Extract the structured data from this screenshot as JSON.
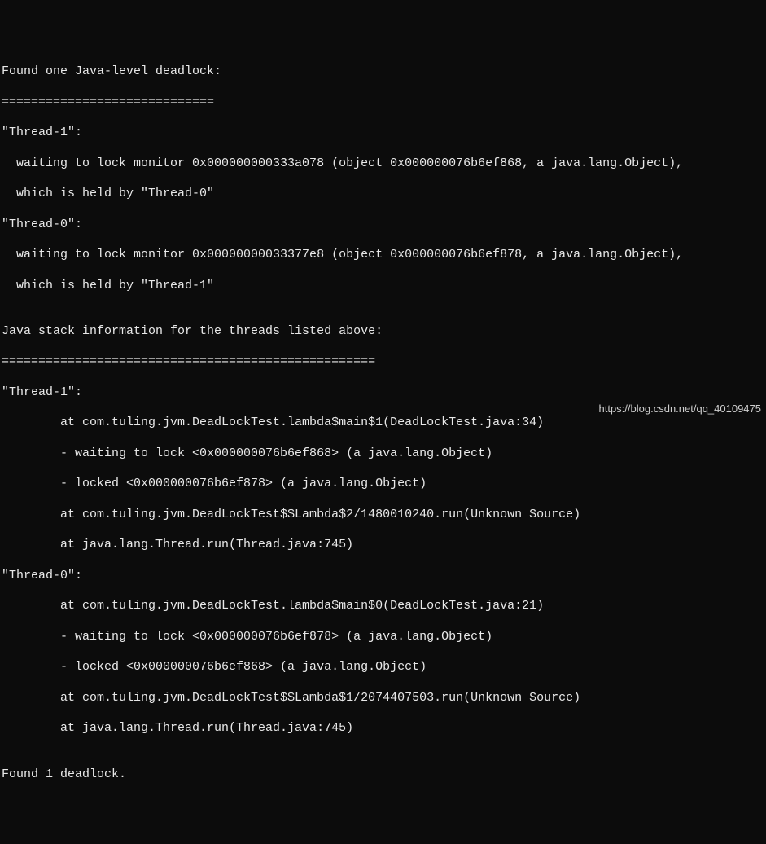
{
  "lines": {
    "l1": "Found one Java-level deadlock:",
    "l2": "=============================",
    "l3": "\"Thread-1\":",
    "l4": "  waiting to lock monitor 0x000000000333a078 (object 0x000000076b6ef868, a java.lang.Object),",
    "l5": "  which is held by \"Thread-0\"",
    "l6": "\"Thread-0\":",
    "l7": "  waiting to lock monitor 0x00000000033377e8 (object 0x000000076b6ef878, a java.lang.Object),",
    "l8": "  which is held by \"Thread-1\"",
    "l9": "",
    "l10": "Java stack information for the threads listed above:",
    "l11": "===================================================",
    "l12": "\"Thread-1\":",
    "l13": "        at com.tuling.jvm.DeadLockTest.lambda$main$1(DeadLockTest.java:34)",
    "l14": "        - waiting to lock <0x000000076b6ef868> (a java.lang.Object)",
    "l15": "        - locked <0x000000076b6ef878> (a java.lang.Object)",
    "l16": "        at com.tuling.jvm.DeadLockTest$$Lambda$2/1480010240.run(Unknown Source)",
    "l17": "        at java.lang.Thread.run(Thread.java:745)",
    "l18": "\"Thread-0\":",
    "l19": "        at com.tuling.jvm.DeadLockTest.lambda$main$0(DeadLockTest.java:21)",
    "l20": "        - waiting to lock <0x000000076b6ef878> (a java.lang.Object)",
    "l21": "        - locked <0x000000076b6ef868> (a java.lang.Object)",
    "l22": "        at com.tuling.jvm.DeadLockTest$$Lambda$1/2074407503.run(Unknown Source)",
    "l23": "        at java.lang.Thread.run(Thread.java:745)",
    "l24": "",
    "l25": "Found 1 deadlock."
  },
  "watermark": "https://blog.csdn.net/qq_40109475"
}
